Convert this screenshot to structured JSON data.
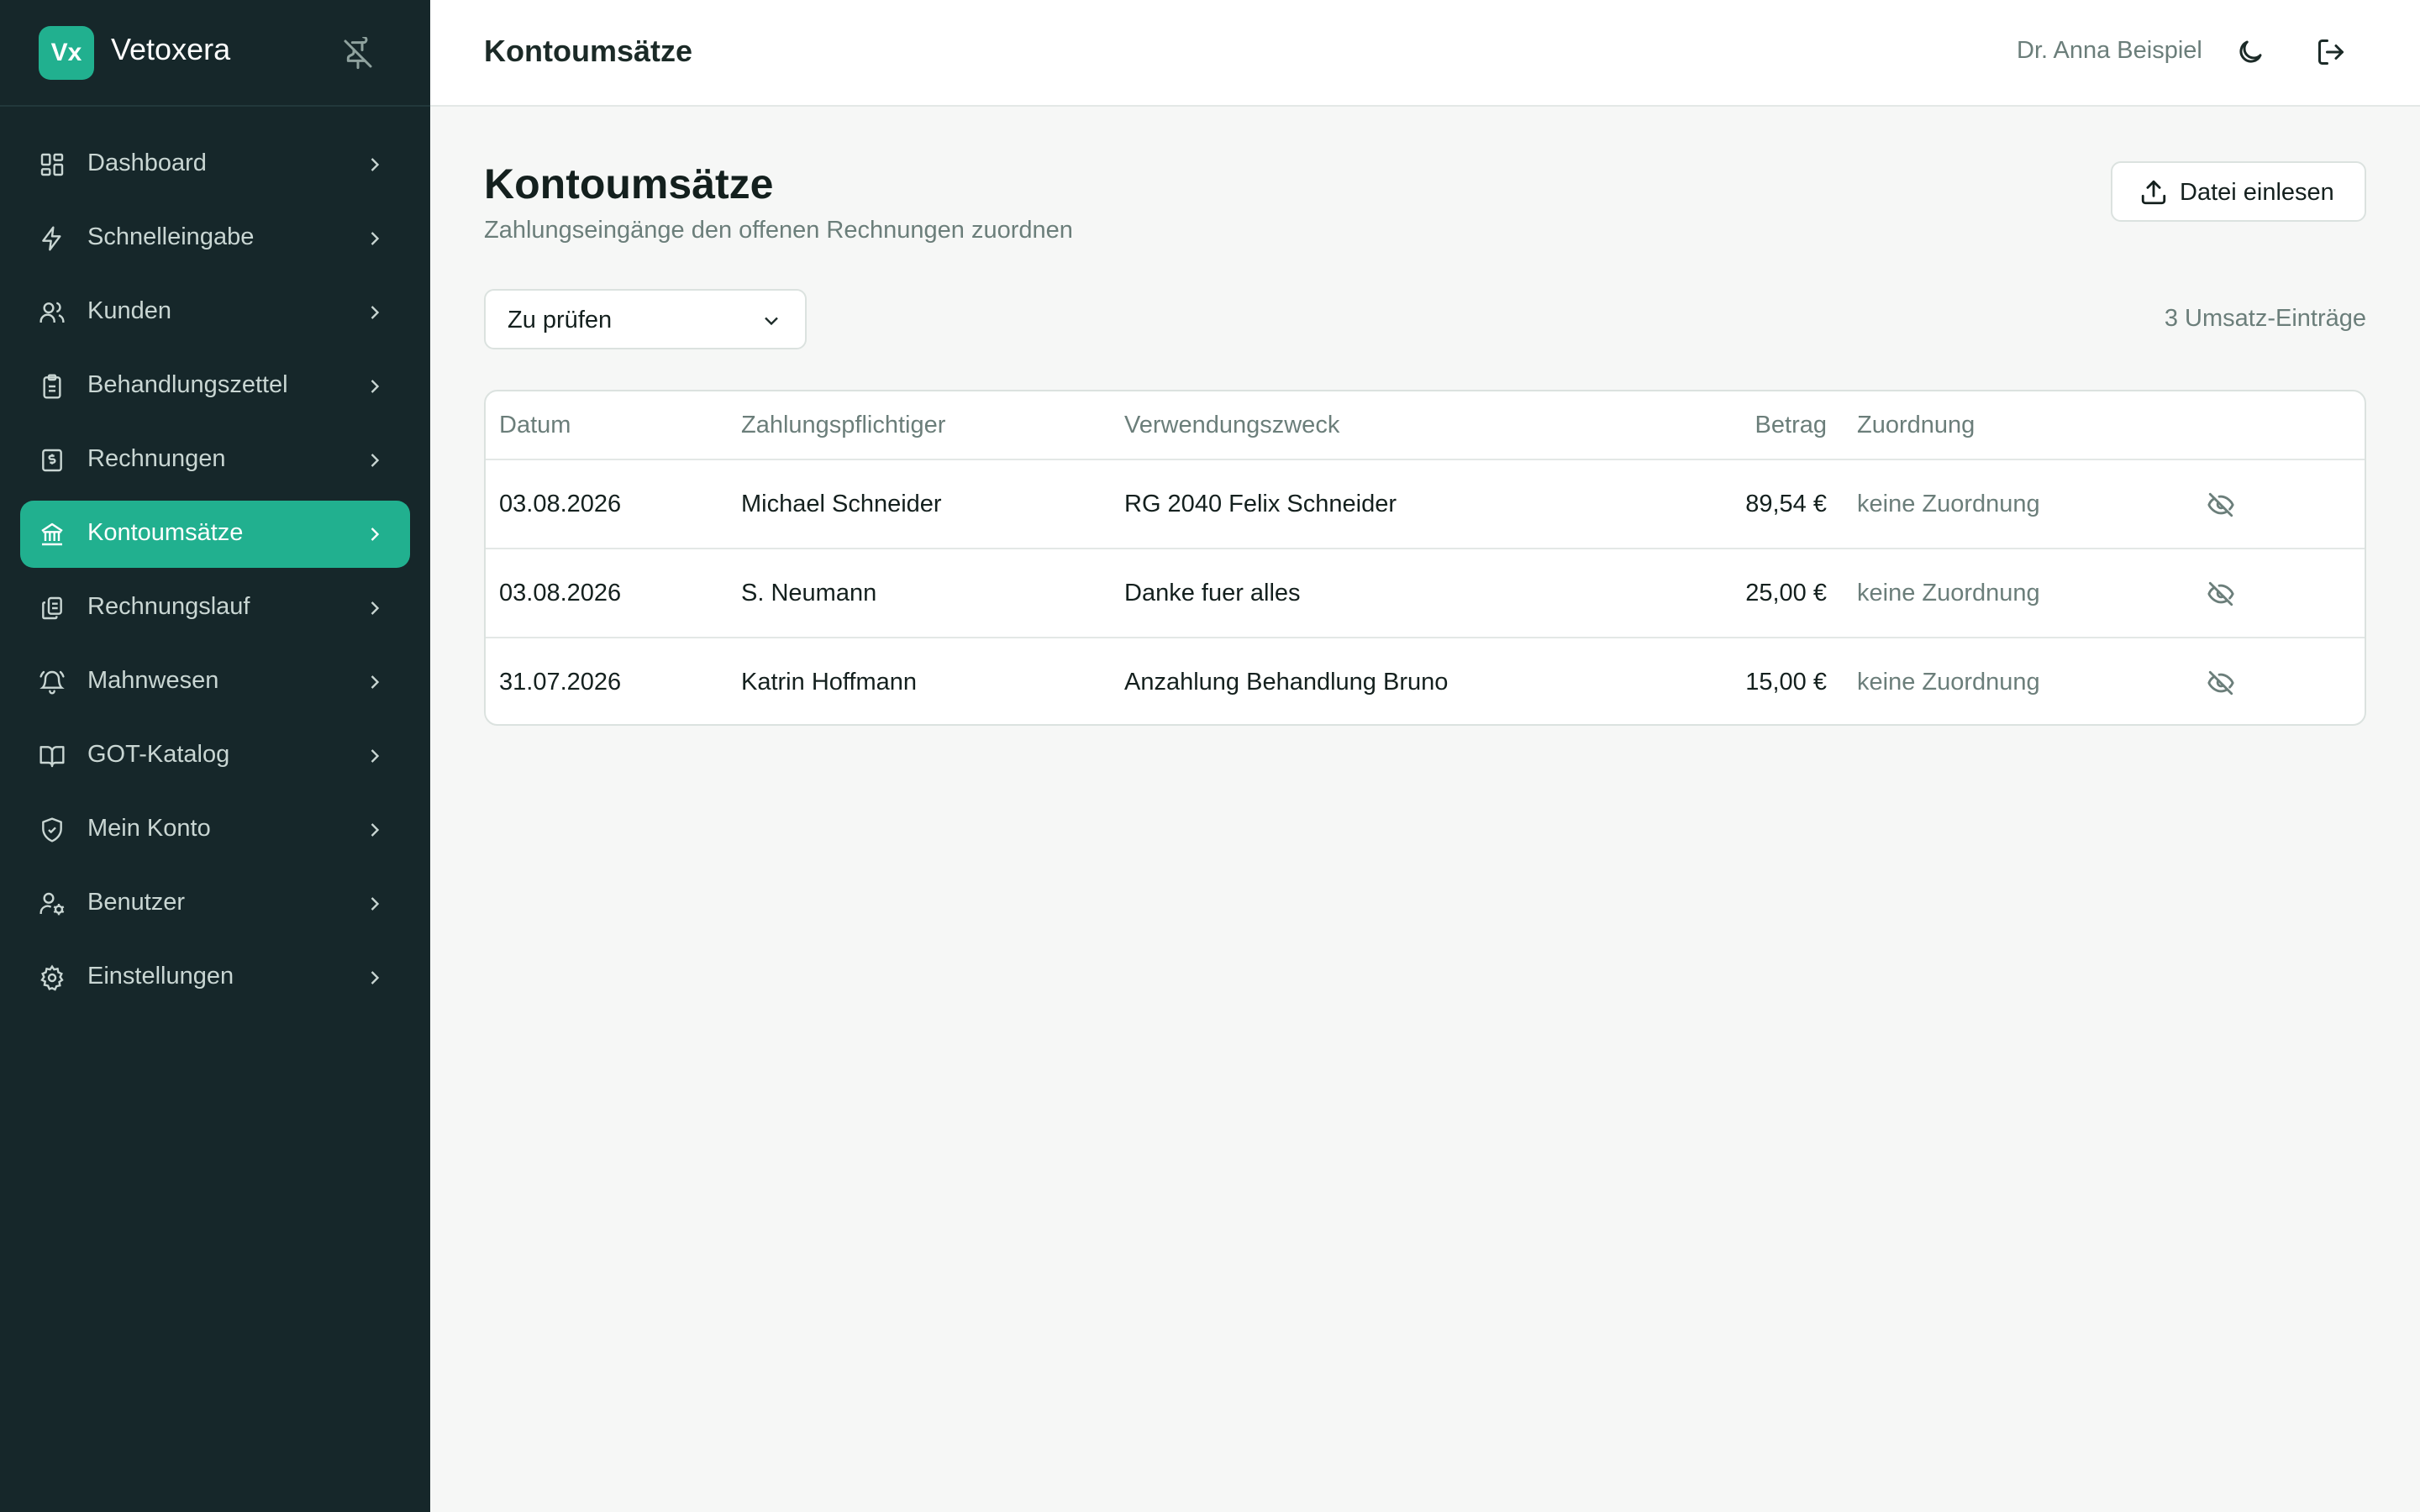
{
  "brand": {
    "logo": "Vx",
    "name": "Vetoxera"
  },
  "nav": [
    {
      "label": "Dashboard",
      "icon": "dashboard-icon",
      "active": false
    },
    {
      "label": "Schnelleingabe",
      "icon": "lightning-icon",
      "active": false
    },
    {
      "label": "Kunden",
      "icon": "users-icon",
      "active": false
    },
    {
      "label": "Behandlungszettel",
      "icon": "clipboard-icon",
      "active": false
    },
    {
      "label": "Rechnungen",
      "icon": "invoice-icon",
      "active": false
    },
    {
      "label": "Kontoumsätze",
      "icon": "bank-icon",
      "active": true
    },
    {
      "label": "Rechnungslauf",
      "icon": "files-icon",
      "active": false
    },
    {
      "label": "Mahnwesen",
      "icon": "bell-icon",
      "active": false
    },
    {
      "label": "GOT-Katalog",
      "icon": "book-icon",
      "active": false
    },
    {
      "label": "Mein Konto",
      "icon": "shield-icon",
      "active": false
    },
    {
      "label": "Benutzer",
      "icon": "user-cog-icon",
      "active": false
    },
    {
      "label": "Einstellungen",
      "icon": "gear-icon",
      "active": false
    }
  ],
  "header": {
    "title": "Kontoumsätze",
    "user": "Dr. Anna Beispiel"
  },
  "main": {
    "title": "Kontoumsätze",
    "subtitle": "Zahlungseingänge den offenen Rechnungen zuordnen",
    "import_label": "Datei einlesen",
    "filter_value": "Zu prüfen",
    "count_label": "3 Umsatz-Einträge"
  },
  "table": {
    "columns": [
      "Datum",
      "Zahlungspflichtiger",
      "Verwendungszweck",
      "Betrag",
      "Zuordnung"
    ],
    "rows": [
      {
        "date": "03.08.2026",
        "payer": "Michael Schneider",
        "purpose": "RG 2040 Felix Schneider",
        "amount": "89,54 €",
        "assignment": "keine Zuordnung"
      },
      {
        "date": "03.08.2026",
        "payer": "S. Neumann",
        "purpose": "Danke fuer alles",
        "amount": "25,00 €",
        "assignment": "keine Zuordnung"
      },
      {
        "date": "31.07.2026",
        "payer": "Katrin Hoffmann",
        "purpose": "Anzahlung Behandlung Bruno",
        "amount": "15,00 €",
        "assignment": "keine Zuordnung"
      }
    ]
  },
  "colors": {
    "accent": "#21b08f",
    "sidebar_bg": "#16272a",
    "muted_text": "#6b7e7a"
  }
}
